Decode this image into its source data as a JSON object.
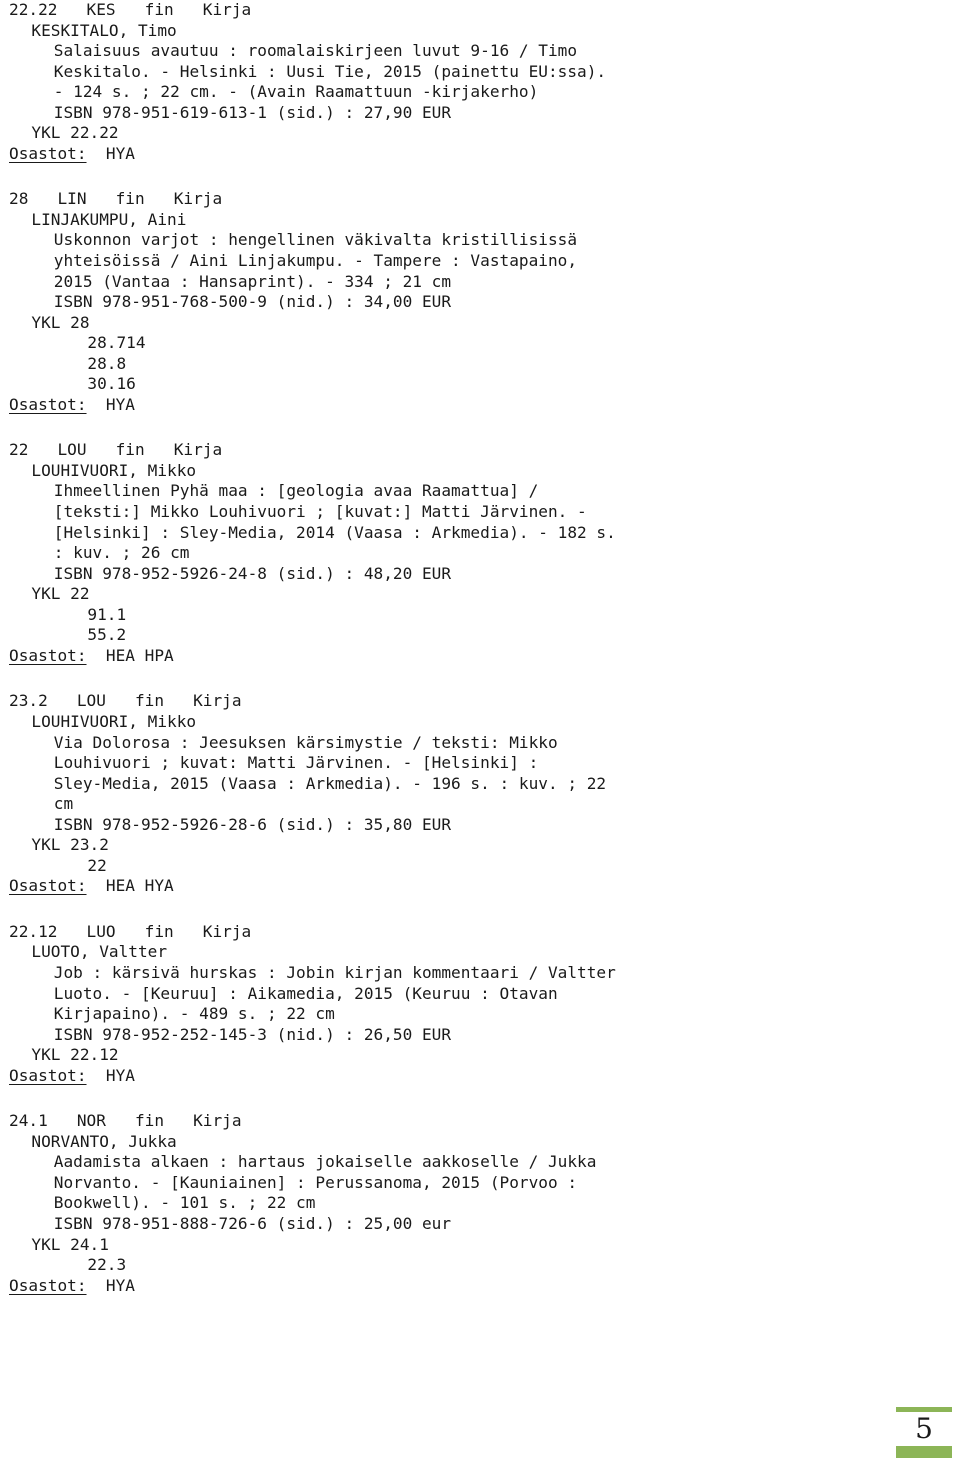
{
  "document": {
    "type": "library-catalogue-listing",
    "language_code": "fin",
    "material_type": "Kirja",
    "osastot_label": "Osastot:"
  },
  "records": [
    {
      "header": "22.22   KES   fin   Kirja",
      "class_number": "22.22",
      "author_code": "KES",
      "language": "fin",
      "material": "Kirja",
      "author": "KESKITALO, Timo",
      "description_lines": [
        "Salaisuus avautuu : roomalaiskirjeen luvut 9-16 / Timo",
        "Keskitalo. - Helsinki : Uusi Tie, 2015 (painettu EU:ssa).",
        "- 124 s. ; 22 cm. - (Avain Raamattuun -kirjakerho)",
        "ISBN 978-951-619-613-1 (sid.) : 27,90 EUR"
      ],
      "ykl_main": "YKL 22.22",
      "ykl_extra": [],
      "osastot_label": "Osastot:",
      "osastot_value": "HYA"
    },
    {
      "header": "28   LIN   fin   Kirja",
      "class_number": "28",
      "author_code": "LIN",
      "language": "fin",
      "material": "Kirja",
      "author": "LINJAKUMPU, Aini",
      "description_lines": [
        "Uskonnon varjot : hengellinen väkivalta kristillisissä",
        "yhteisöissä / Aini Linjakumpu. - Tampere : Vastapaino,",
        "2015 (Vantaa : Hansaprint). - 334 ; 21 cm",
        "ISBN 978-951-768-500-9 (nid.) : 34,00 EUR"
      ],
      "ykl_main": "YKL 28",
      "ykl_extra": [
        "28.714",
        "28.8",
        "30.16"
      ],
      "osastot_label": "Osastot:",
      "osastot_value": "HYA"
    },
    {
      "header": "22   LOU   fin   Kirja",
      "class_number": "22",
      "author_code": "LOU",
      "language": "fin",
      "material": "Kirja",
      "author": "LOUHIVUORI, Mikko",
      "description_lines": [
        "Ihmeellinen Pyhä maa : [geologia avaa Raamattua] /",
        "[teksti:] Mikko Louhivuori ; [kuvat:] Matti Järvinen. -",
        "[Helsinki] : Sley-Media, 2014 (Vaasa : Arkmedia). - 182 s.",
        ": kuv. ; 26 cm",
        "ISBN 978-952-5926-24-8 (sid.) : 48,20 EUR"
      ],
      "ykl_main": "YKL 22",
      "ykl_extra": [
        "91.1",
        "55.2"
      ],
      "osastot_label": "Osastot:",
      "osastot_value": "HEA HPA"
    },
    {
      "header": "23.2   LOU   fin   Kirja",
      "class_number": "23.2",
      "author_code": "LOU",
      "language": "fin",
      "material": "Kirja",
      "author": "LOUHIVUORI, Mikko",
      "description_lines": [
        "Via Dolorosa : Jeesuksen kärsimystie / teksti: Mikko",
        "Louhivuori ; kuvat: Matti Järvinen. - [Helsinki] :",
        "Sley-Media, 2015 (Vaasa : Arkmedia). - 196 s. : kuv. ; 22",
        "cm",
        "ISBN 978-952-5926-28-6 (sid.) : 35,80 EUR"
      ],
      "ykl_main": "YKL 23.2",
      "ykl_extra": [
        "22"
      ],
      "osastot_label": "Osastot:",
      "osastot_value": "HEA HYA"
    },
    {
      "header": "22.12   LUO   fin   Kirja",
      "class_number": "22.12",
      "author_code": "LUO",
      "language": "fin",
      "material": "Kirja",
      "author": "LUOTO, Valtter",
      "description_lines": [
        "Job : kärsivä hurskas : Jobin kirjan kommentaari / Valtter",
        "Luoto. - [Keuruu] : Aikamedia, 2015 (Keuruu : Otavan",
        "Kirjapaino). - 489 s. ; 22 cm",
        "ISBN 978-952-252-145-3 (nid.) : 26,50 EUR"
      ],
      "ykl_main": "YKL 22.12",
      "ykl_extra": [],
      "osastot_label": "Osastot:",
      "osastot_value": "HYA"
    },
    {
      "header": "24.1   NOR   fin   Kirja",
      "class_number": "24.1",
      "author_code": "NOR",
      "language": "fin",
      "material": "Kirja",
      "author": "NORVANTO, Jukka",
      "description_lines": [
        "Aadamista alkaen : hartaus jokaiselle aakkoselle / Jukka",
        "Norvanto. - [Kauniainen] : Perussanoma, 2015 (Porvoo :",
        "Bookwell). - 101 s. ; 22 cm",
        "ISBN 978-951-888-726-6 (sid.) : 25,00 eur"
      ],
      "ykl_main": "YKL 24.1",
      "ykl_extra": [
        "22.3"
      ],
      "osastot_label": "Osastot:",
      "osastot_value": "HYA"
    }
  ],
  "footer": {
    "page_number": "5",
    "accent_color": "#8cb557"
  }
}
